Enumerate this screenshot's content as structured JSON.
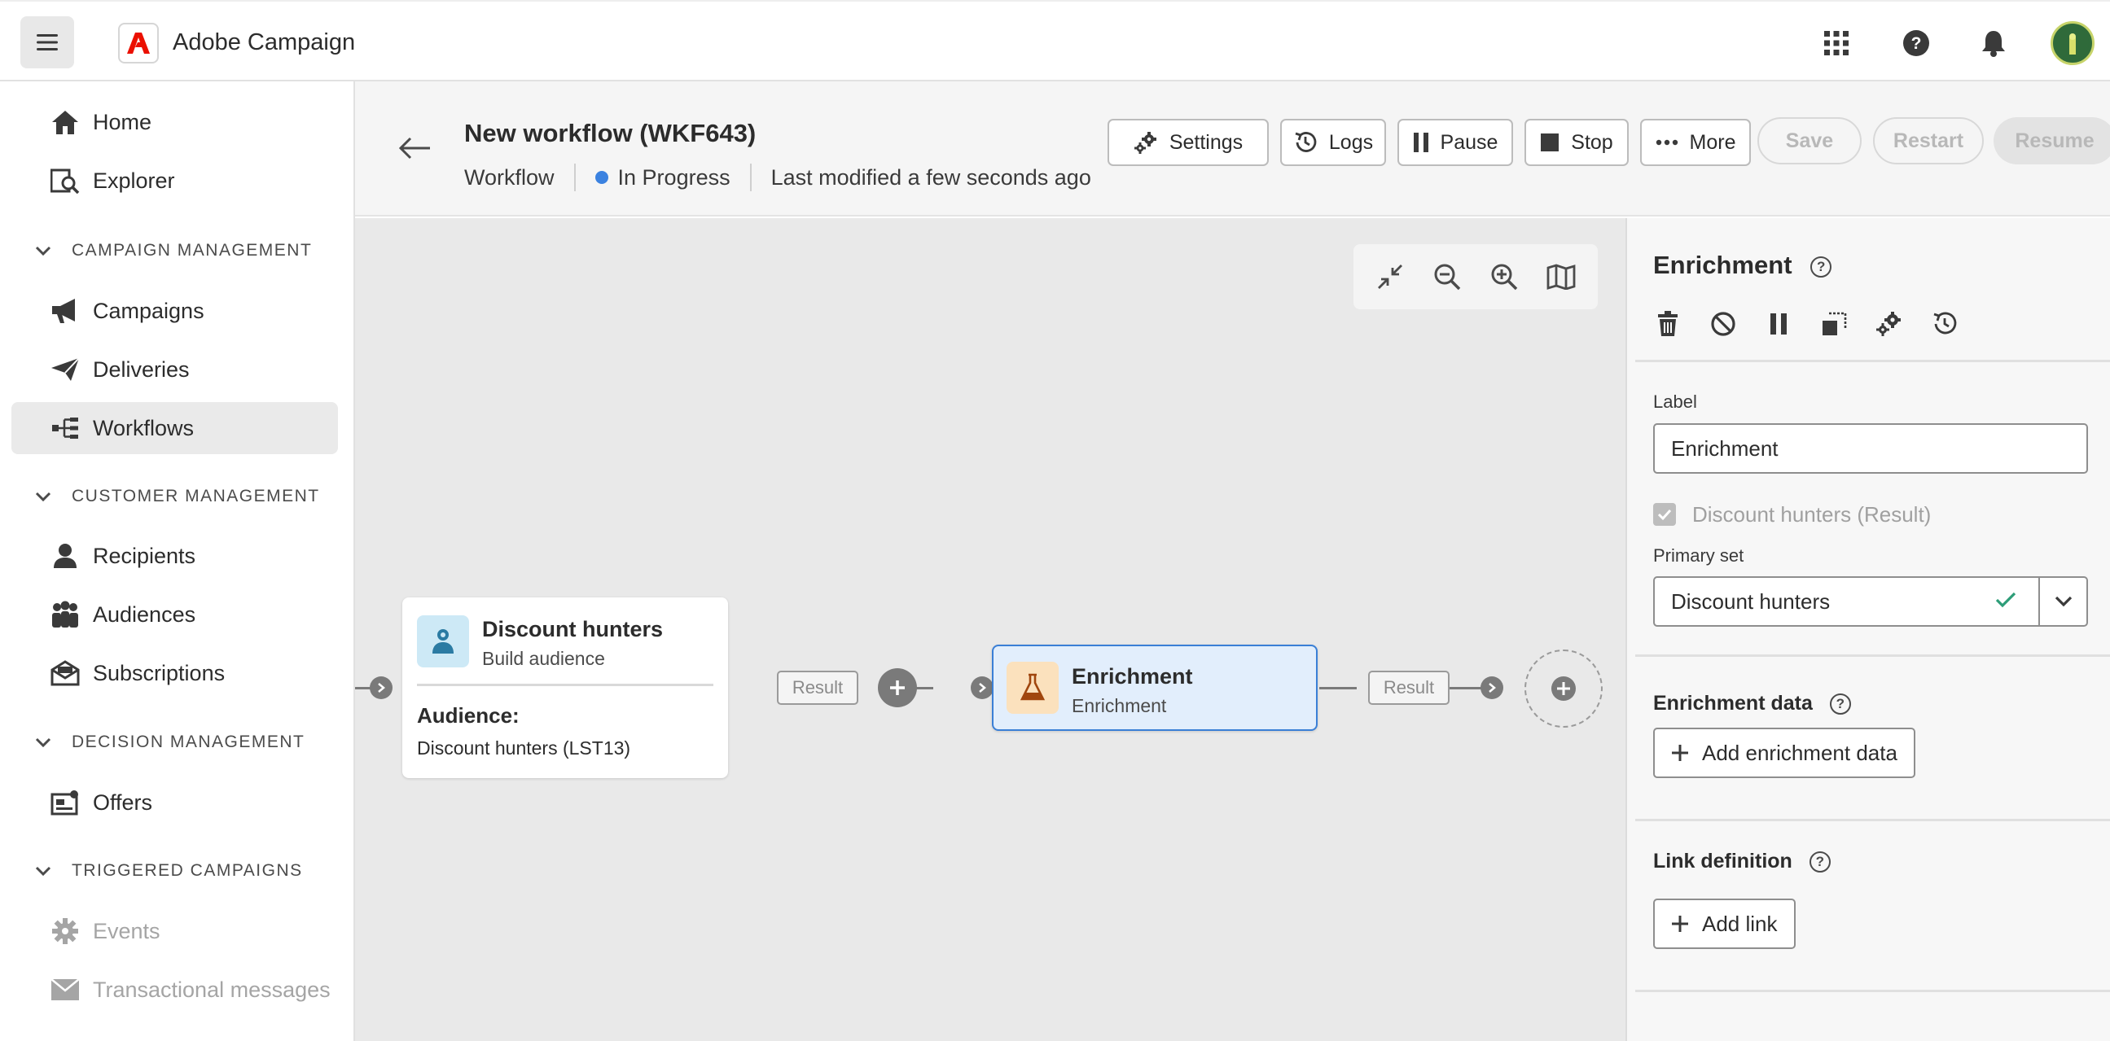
{
  "app": {
    "name": "Adobe Campaign",
    "accent": "#EB1000"
  },
  "header_icons": [
    "apps-grid-icon",
    "help-icon",
    "notifications-bell-icon",
    "user-avatar"
  ],
  "sidebar": {
    "top_items": [
      {
        "label": "Home",
        "icon": "home-icon"
      },
      {
        "label": "Explorer",
        "icon": "explorer-icon"
      }
    ],
    "sections": [
      {
        "title": "CAMPAIGN MANAGEMENT",
        "items": [
          {
            "label": "Campaigns",
            "icon": "megaphone-icon"
          },
          {
            "label": "Deliveries",
            "icon": "send-icon"
          },
          {
            "label": "Workflows",
            "icon": "workflow-icon",
            "active": true
          }
        ]
      },
      {
        "title": "CUSTOMER MANAGEMENT",
        "items": [
          {
            "label": "Recipients",
            "icon": "user-icon"
          },
          {
            "label": "Audiences",
            "icon": "users-icon"
          },
          {
            "label": "Subscriptions",
            "icon": "envelope-icon"
          }
        ]
      },
      {
        "title": "DECISION MANAGEMENT",
        "items": [
          {
            "label": "Offers",
            "icon": "offer-icon"
          }
        ]
      },
      {
        "title": "TRIGGERED CAMPAIGNS",
        "items": [
          {
            "label": "Events",
            "icon": "gear-icon",
            "disabled": true
          },
          {
            "label": "Transactional messages",
            "icon": "mail-icon",
            "disabled": true
          }
        ]
      }
    ]
  },
  "workflow": {
    "title": "New workflow (WKF643)",
    "type": "Workflow",
    "status": "In Progress",
    "status_color": "#3B82E0",
    "modified": "Last modified a few seconds ago",
    "buttons": {
      "settings": "Settings",
      "logs": "Logs",
      "pause": "Pause",
      "stop": "Stop",
      "more": "More"
    },
    "actions": {
      "save": "Save",
      "restart": "Restart",
      "resume": "Resume"
    }
  },
  "canvas": {
    "source_node": {
      "title": "Discount hunters",
      "subtitle": "Build audience",
      "audience_label": "Audience:",
      "audience_value": "Discount hunters (LST13)"
    },
    "result_label_1": "Result",
    "enrichment_node": {
      "title": "Enrichment",
      "subtitle": "Enrichment",
      "selected": true
    },
    "result_label_2": "Result"
  },
  "panel": {
    "title": "Enrichment",
    "toolbar_icons": [
      "delete-icon",
      "disable-icon",
      "pause-icon",
      "copy-icon",
      "settings-icon",
      "history-icon"
    ],
    "label_field": {
      "label": "Label",
      "value": "Enrichment"
    },
    "input_checkbox": {
      "label": "Discount hunters (Result)",
      "checked": true,
      "disabled": true
    },
    "primary_set": {
      "label": "Primary set",
      "value": "Discount hunters"
    },
    "enrichment_data": {
      "title": "Enrichment data",
      "button": "Add enrichment data"
    },
    "link_definition": {
      "title": "Link definition",
      "button": "Add link"
    }
  }
}
